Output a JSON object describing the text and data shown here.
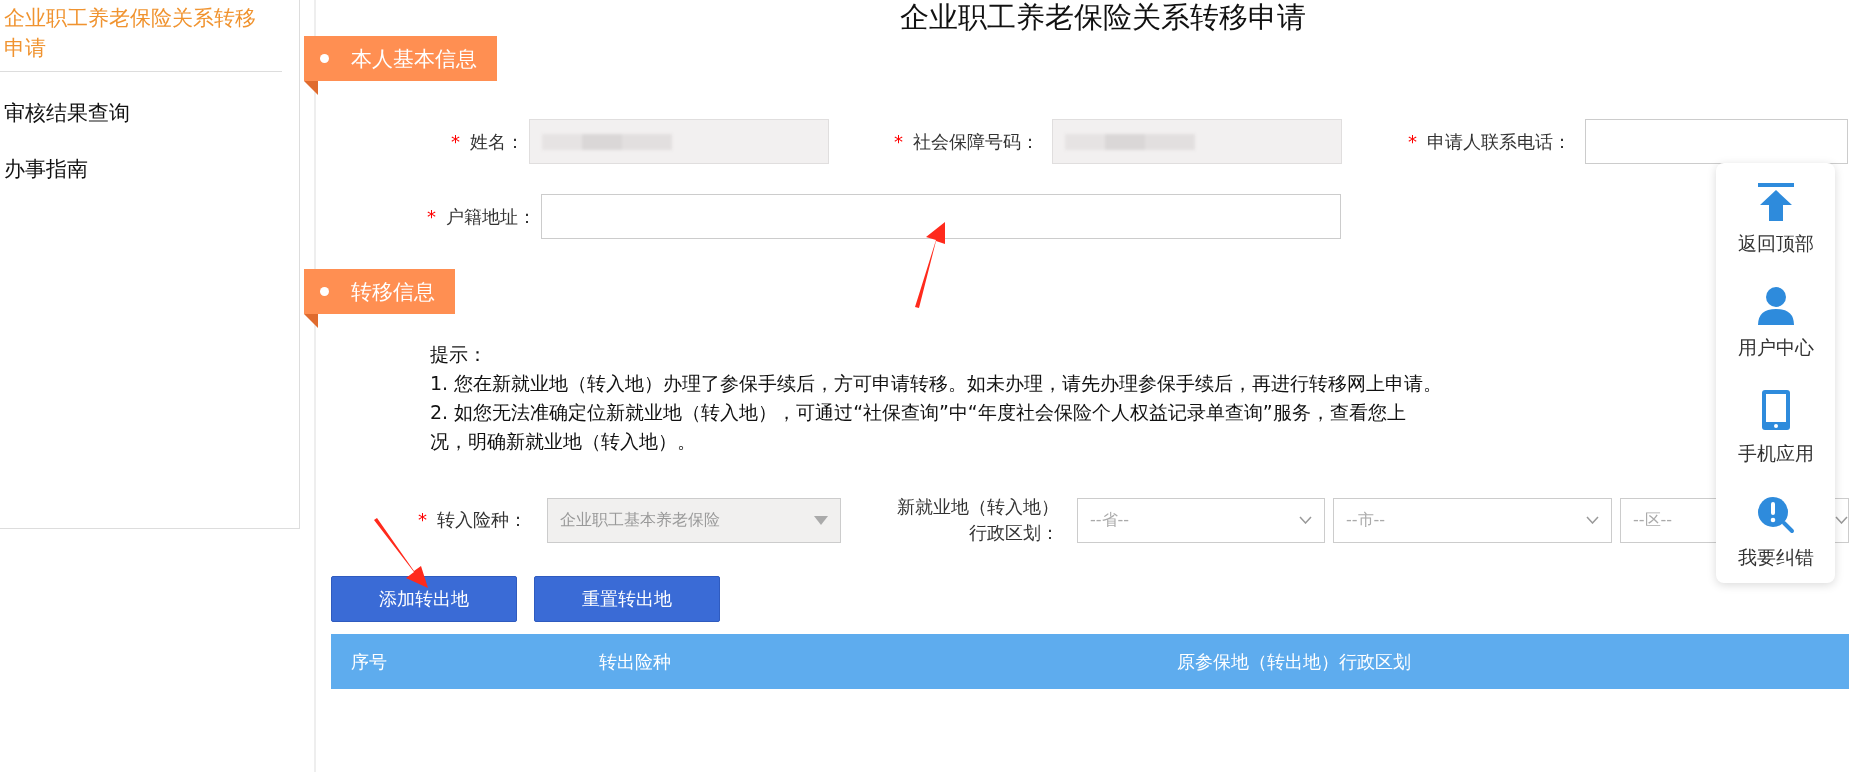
{
  "sidebar": {
    "items": [
      {
        "label": "企业职工养老保险关系转移申请",
        "selected": true
      },
      {
        "label": "审核结果查询",
        "selected": false
      },
      {
        "label": "办事指南",
        "selected": false
      }
    ]
  },
  "page_title": "企业职工养老保险关系转移申请",
  "basic_info": {
    "title": "本人基本信息",
    "rows": [
      [
        {
          "required_mark": "*",
          "label": "姓名：",
          "kind": "redacted"
        },
        {
          "required_mark": "*",
          "label": "社会保障号码：",
          "kind": "redacted"
        },
        {
          "required_mark": "*",
          "label": "申请人联系电话：",
          "kind": "text"
        }
      ],
      [
        {
          "required_mark": "*",
          "label": "户籍地址：",
          "kind": "text"
        }
      ]
    ]
  },
  "transfer_info": {
    "title": "转移信息",
    "tips": {
      "heading": "提示：",
      "lines": [
        "1. 您在新就业地（转入地）办理了参保手续后，方可申请转移。如未办理，请先办理参保手续后，再进行转移网上申请。",
        "2. 如您无法准确定位新就业地（转入地），可通过“社保查询”中“年度社会保险个人权益记录单查询”服务，查看您上",
        "况，明确新就业地（转入地）。"
      ]
    },
    "insurance_type": {
      "required_mark": "*",
      "label": "转入险种：",
      "value": "企业职工基本养老保险",
      "disabled": true
    },
    "region": {
      "label": "新就业地（转入地）行政区划：",
      "selects": [
        {
          "value": "--省--"
        },
        {
          "value": "--市--"
        },
        {
          "value": "--区--"
        }
      ]
    },
    "buttons": [
      "添加转出地",
      "重置转出地"
    ],
    "table": {
      "columns": [
        "序号",
        "转出险种",
        "原参保地（转出地）行政区划"
      ]
    }
  },
  "float_panel": {
    "items": [
      {
        "kind": "top",
        "label": "返回顶部"
      },
      {
        "kind": "user",
        "label": "用户中心"
      },
      {
        "kind": "phone",
        "label": "手机应用"
      },
      {
        "kind": "feedback",
        "label": "我要纠错"
      }
    ]
  }
}
